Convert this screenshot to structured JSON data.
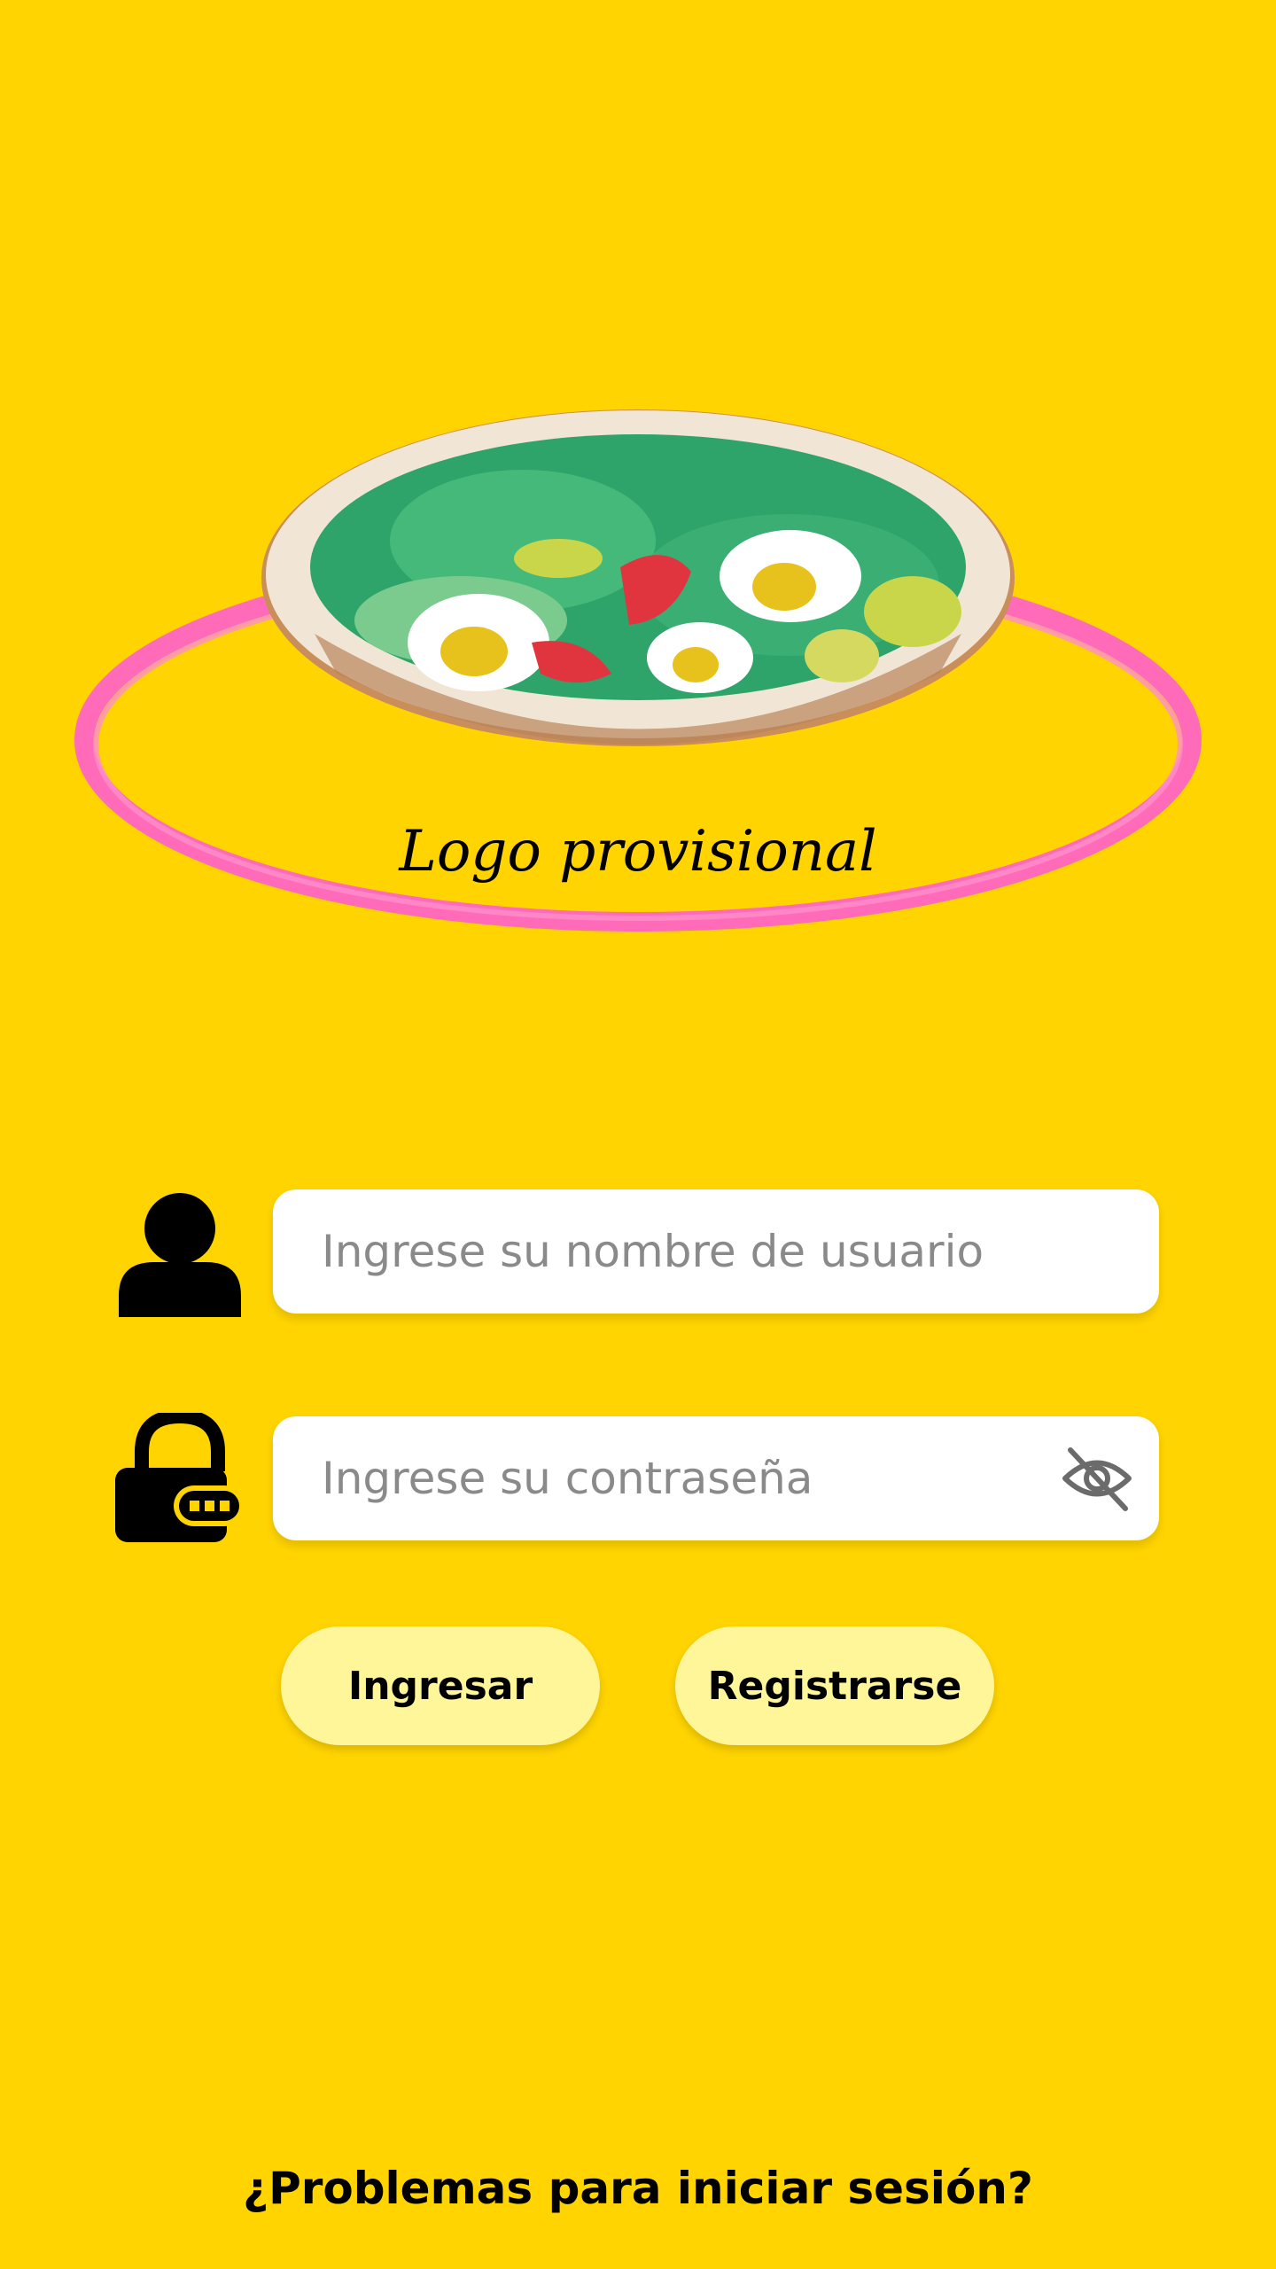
{
  "colors": {
    "background": "#FFD400",
    "button": "#FFF69A",
    "field": "#FFFFFF",
    "logo_ring": "#FF6BB8"
  },
  "logo": {
    "text": "Logo provisional",
    "icon": "salad-bowl-logo"
  },
  "login_form": {
    "username_icon": "user-icon",
    "username_placeholder": "Ingrese su nombre de usuario",
    "username_value": "",
    "password_icon": "lock-icon",
    "password_placeholder": "Ingrese su contraseña",
    "password_value": "",
    "visibility_icon": "eye-off-icon"
  },
  "actions": {
    "login_label": "Ingresar",
    "register_label": "Registrarse"
  },
  "help": {
    "link_text": "¿Problemas para iniciar sesión?"
  }
}
